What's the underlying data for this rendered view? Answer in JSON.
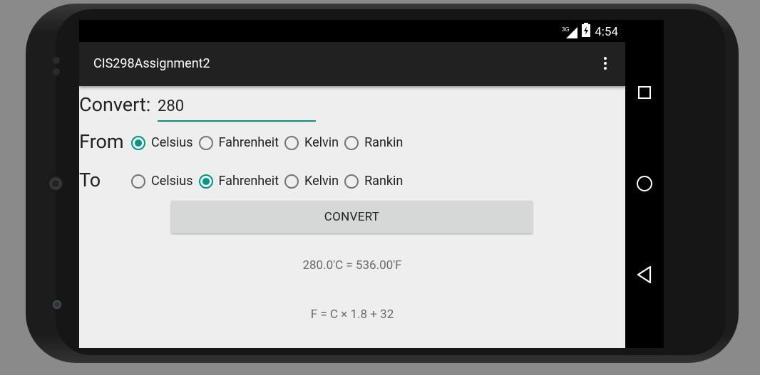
{
  "status": {
    "network": "3G",
    "time": "4:54"
  },
  "app": {
    "title": "CIS298Assignment2"
  },
  "form": {
    "convert_label": "Convert:",
    "input_value": "280",
    "from_label": "From",
    "to_label": "To",
    "from_options": [
      {
        "label": "Celsius",
        "checked": true
      },
      {
        "label": "Fahrenheit",
        "checked": false
      },
      {
        "label": "Kelvin",
        "checked": false
      },
      {
        "label": "Rankin",
        "checked": false
      }
    ],
    "to_options": [
      {
        "label": "Celsius",
        "checked": false
      },
      {
        "label": "Fahrenheit",
        "checked": true
      },
      {
        "label": "Kelvin",
        "checked": false
      },
      {
        "label": "Rankin",
        "checked": false
      }
    ],
    "convert_button": "CONVERT",
    "result": "280.0'C = 536.00'F",
    "formula": "F =  C × 1.8 + 32"
  },
  "colors": {
    "accent": "#009688",
    "actionbar": "#212121",
    "background": "#eeeeee"
  },
  "icons": [
    "signal-icon",
    "battery-icon",
    "overflow-menu-icon",
    "recents-icon",
    "home-icon",
    "back-icon"
  ]
}
